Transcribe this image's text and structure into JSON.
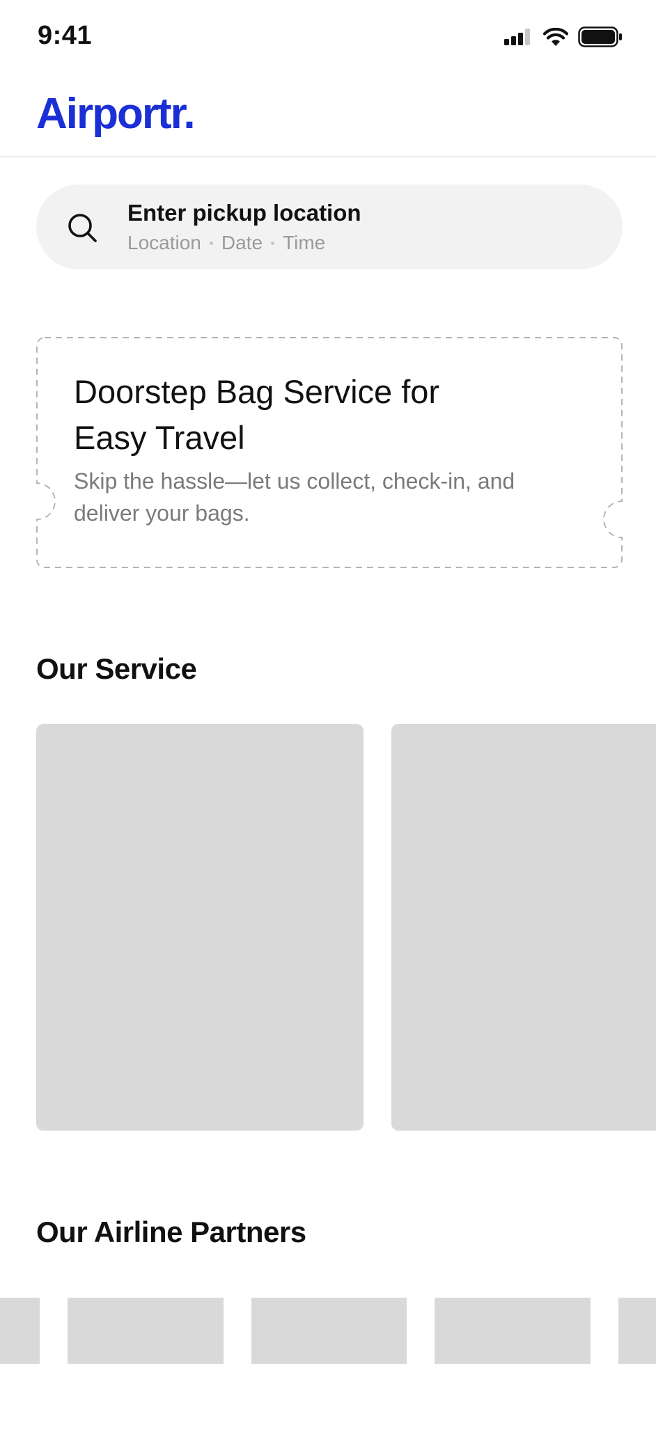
{
  "status_bar": {
    "time": "9:41",
    "icons": [
      "cellular-signal-icon",
      "wifi-icon",
      "battery-icon"
    ]
  },
  "header": {
    "logo_text": "Airportr.",
    "brand_color": "#1a2fd6"
  },
  "search": {
    "icon": "search-icon",
    "title": "Enter pickup location",
    "meta": [
      "Location",
      "Date",
      "Time"
    ]
  },
  "promo": {
    "title_line1": "Doorstep Bag Service for",
    "title_line2": "Easy Travel",
    "description": "Skip the hassle—let us collect, check-in, and deliver your bags."
  },
  "services": {
    "heading": "Our Service",
    "card_count": 2
  },
  "partners": {
    "heading": "Our Airline Partners",
    "logo_count": 5
  },
  "colors": {
    "placeholder_gray": "#d9d9d9",
    "search_bg": "#f2f2f2",
    "muted_text": "#7a7a7a"
  }
}
